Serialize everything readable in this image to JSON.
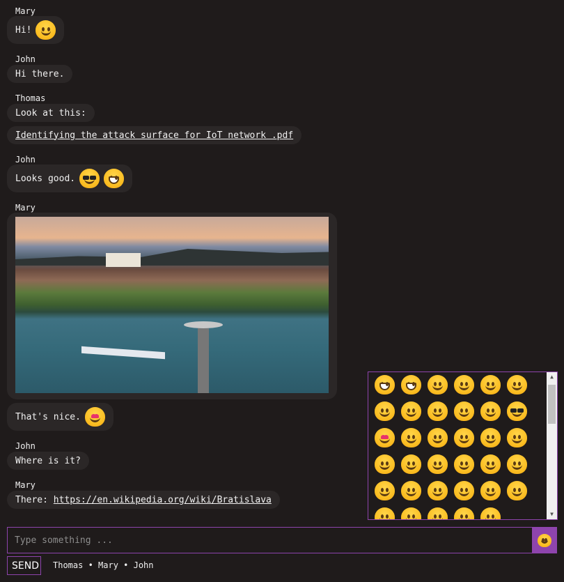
{
  "messages": [
    {
      "sender": "Mary",
      "text": "Hi!",
      "emoji": [
        "smiling-face"
      ]
    },
    {
      "sender": "John",
      "text": "Hi there."
    },
    {
      "sender": "Thomas",
      "text": "Look at this:",
      "attachment": "Identifying the attack surface for IoT network .pdf"
    },
    {
      "sender": "John",
      "text": "Looks good.",
      "emoji": [
        "sunglasses-face",
        "grinning-face"
      ]
    },
    {
      "sender": "Mary",
      "image_icon": "city-photo"
    },
    {
      "text": "That's nice.",
      "emoji": [
        "heart-eyes-face"
      ]
    },
    {
      "sender": "John",
      "text": "Where is it?"
    },
    {
      "sender": "Mary",
      "text_prefix": "There: ",
      "link": "https://en.wikipedia.org/wiki/Bratislava"
    }
  ],
  "composer": {
    "placeholder": "Type something ...",
    "emoji_button_icon": "smiley-icon"
  },
  "send_label": "SEND",
  "online_users": "Thomas • Mary • John",
  "emoji_panel": {
    "icons": [
      "grinning",
      "beaming",
      "tears-of-joy",
      "rofl",
      "smiley",
      "smile",
      "sweat-smile",
      "laughing",
      "wink",
      "blush",
      "yum",
      "sunglasses",
      "heart-eyes",
      "kissing-heart",
      "kissing",
      "kissing-smiling-eyes",
      "kissing-closed-eyes",
      "slightly-smiling",
      "hugging",
      "thinking",
      "neutral",
      "expressionless",
      "no-mouth",
      "rolling-eyes",
      "smirk",
      "persevere",
      "disappointed-relieved",
      "open-mouth",
      "zipper-mouth",
      "hushed",
      "sleepy",
      "tired",
      "sleeping",
      "relieved",
      "nerd"
    ]
  }
}
